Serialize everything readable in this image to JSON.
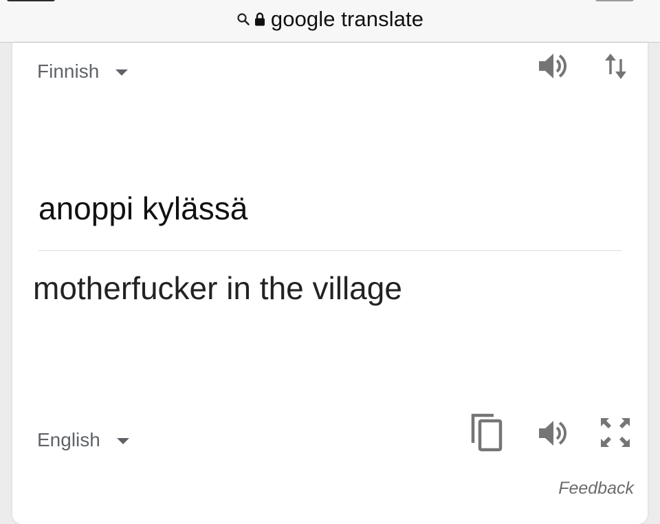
{
  "browser": {
    "url_label": "google translate",
    "icons": [
      "search-icon",
      "lock-icon"
    ]
  },
  "source": {
    "language": "Finnish",
    "text": "anoppi kylässä"
  },
  "target": {
    "language": "English",
    "text": "motherfucker in the village"
  },
  "actions": {
    "source_icons": [
      "speaker-icon",
      "swap-languages-icon"
    ],
    "target_icons": [
      "copy-icon",
      "speaker-icon",
      "fullscreen-icon"
    ]
  },
  "footer": {
    "feedback_label": "Feedback"
  },
  "colors": {
    "icon_gray": "#757575",
    "label_gray": "#5f6368"
  }
}
